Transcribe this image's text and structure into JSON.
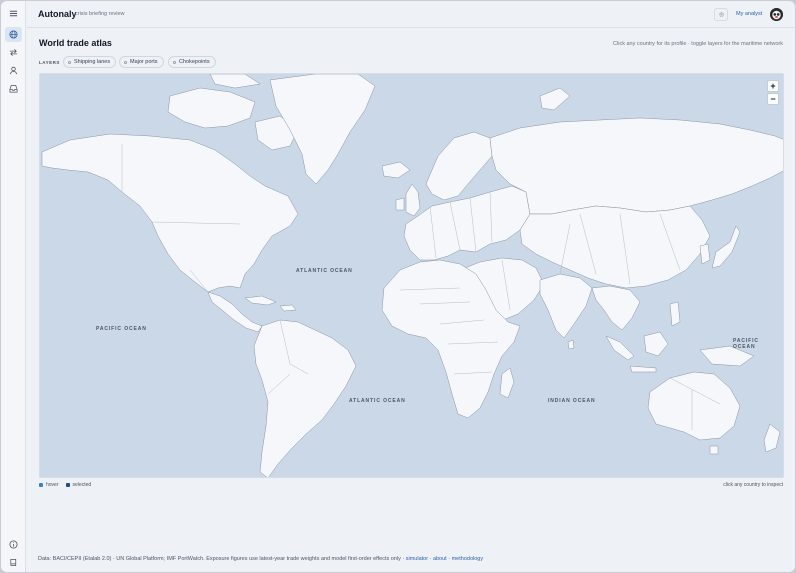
{
  "app": {
    "brand": "Autonaly",
    "subtitle": "crisis briefing review",
    "analyst_link": "My analyst"
  },
  "rail": {
    "top_icons": [
      "menu-icon",
      "globe-icon",
      "arrows-swap-icon",
      "user-icon",
      "inbox-icon"
    ],
    "bottom_icons": [
      "info-icon",
      "book-icon"
    ],
    "active": "globe-icon"
  },
  "page": {
    "title": "World trade atlas",
    "hint": "Click any country for its profile · toggle layers for the maritime network"
  },
  "layers": {
    "label": "LAYERS",
    "chips": [
      "Shipping lanes",
      "Major ports",
      "Chokepoints"
    ]
  },
  "map": {
    "zoom_in": "+",
    "zoom_out": "−",
    "oceans": {
      "atlantic_north": "ATLANTIC OCEAN",
      "pacific_west": "PACIFIC OCEAN",
      "pacific_east": "PACIFIC OCEAN",
      "atlantic_south": "ATLANTIC OCEAN",
      "indian": "INDIAN OCEAN"
    }
  },
  "legend": {
    "hover": "hover",
    "selected": "selected",
    "hover_color": "#3b82c4",
    "selected_color": "#1e4f8c",
    "inspect_hint": "click any country to inspect"
  },
  "footer": {
    "text": "Data: BACI/CEPII (Etalab 2.0) · UN Global Platform; IMF PortWatch. Exposure figures use latest-year trade weights and model first-order effects only ·",
    "links": [
      "simulator",
      "about",
      "methodology"
    ],
    "sep": " · "
  },
  "colors": {
    "accent": "#2f62b0",
    "ocean": "#cad8e8",
    "land": "#f5f7fa",
    "border": "#8a94a3"
  }
}
